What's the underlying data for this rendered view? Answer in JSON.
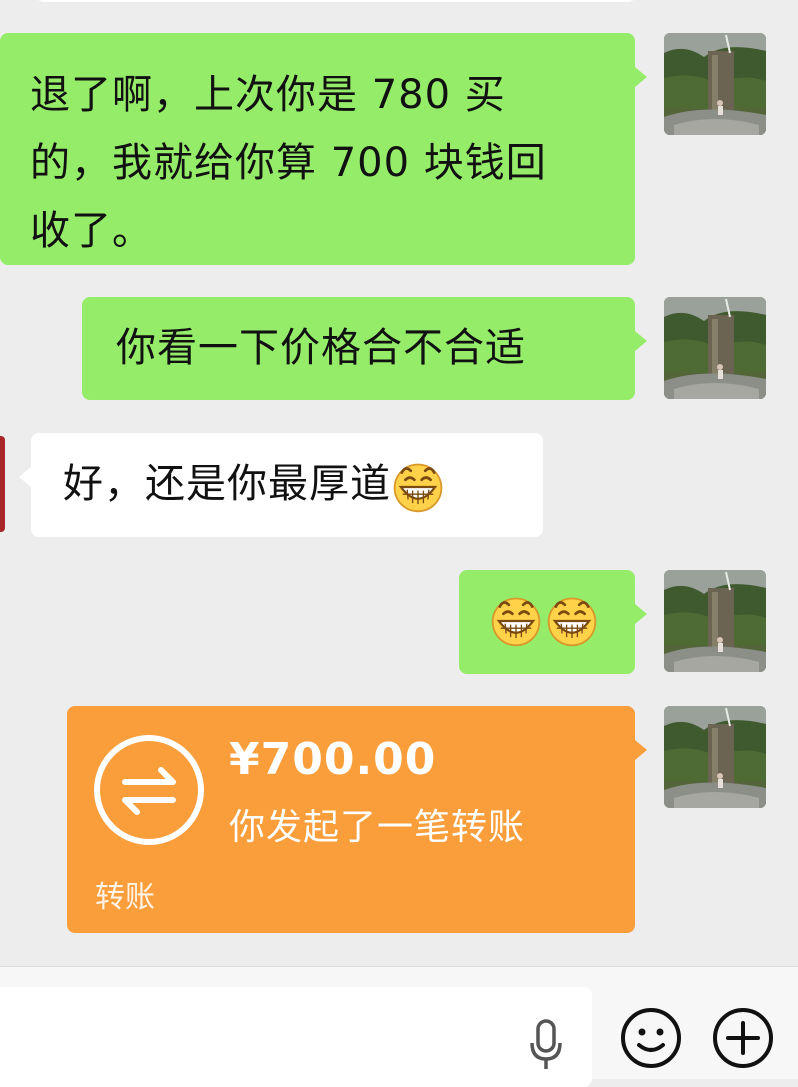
{
  "messages": [
    {
      "side": "me",
      "text": "退了啊，上次你是 780 买\n的，我就给你算 700 块钱回\n收了。"
    },
    {
      "side": "me",
      "text": "你看一下价格合不合适"
    },
    {
      "side": "them",
      "text": "好，还是你最厚道"
    },
    {
      "side": "me",
      "text": ""
    }
  ],
  "transfer": {
    "amount": "¥700.00",
    "subtitle": "你发起了一笔转账",
    "footer": "转账"
  },
  "input_bar": {
    "value": "",
    "icons": [
      "microphone-icon",
      "emoji-icon",
      "plus-icon"
    ]
  },
  "colors": {
    "background": "#ededed",
    "my_bubble": "#95ec69",
    "their_bubble": "#ffffff",
    "transfer_card": "#fa9d3b",
    "peer_avatar_edge": "#a8262a"
  },
  "emoji_name": "grin-emoji"
}
